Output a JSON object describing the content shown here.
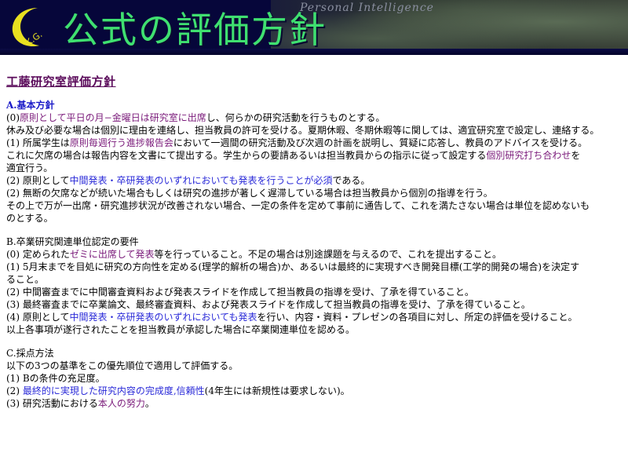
{
  "header": {
    "title": "公式の評価方針",
    "logo_text": "K.G.",
    "motto": "Personal  Intelligence",
    "colors": {
      "title": "#3fe070",
      "logo": "#e8e020",
      "background": "#06063a"
    }
  },
  "doc": {
    "title": "工藤研究室評価方針",
    "sectionA": {
      "heading": "A.基本方針",
      "p0": [
        "(0)",
        "原則として平日の月−金曜日は研究室に出席",
        "し、何らかの研究活動を行うものとする。"
      ],
      "p0b": "休み及び必要な場合は個別に理由を連絡し、担当教員の許可を受ける。夏期休暇、冬期休暇等に関しては、適宜研究室で設定し、連絡する。",
      "p1": [
        "(1) 所属学生は",
        "原則毎週行う進捗報告会",
        "において一週間の研究活動及び次週の計画を説明し、質疑に応答し、教員のアドバイスを受ける。"
      ],
      "p1b": [
        "これに欠席の場合は報告内容を文書にて提出する。学生からの要請あるいは担当教員からの指示に従って設定する",
        "個別研究打ち合わせ",
        "を"
      ],
      "p1c": "適宜行う。",
      "p2": [
        "(2) 原則として",
        "中間発表・卒研発表のいずれにおいても発表を行うことが必須",
        "である。"
      ],
      "p3": "(2) 無断の欠席などが続いた場合もしくは研究の進捗が著しく遅滞している場合は担当教員から個別の指導を行う。",
      "p4": "その上で万が一出席・研究進捗状況が改善されない場合、一定の条件を定めて事前に通告して、これを満たさない場合は単位を認めないも",
      "p4b": "のとする。"
    },
    "sectionB": {
      "heading": "B.卒業研究関連単位認定の要件",
      "p0": [
        "(0) 定められた",
        "ゼミに出席して発表",
        "等を行っていること。不足の場合は別途課題を与えるので、これを提出すること。"
      ],
      "p1": "(1) 5月末までを目処に研究の方向性を定める(理学的解析の場合)か、あるいは最終的に実現すべき開発目標(工学的開発の場合)を決定す",
      "p1b": "ること。",
      "p2": "(2) 中間審査までに中間審査資料および発表スライドを作成して担当教員の指導を受け、了承を得ていること。",
      "p3": "(3) 最終審査までに卒業論文、最終審査資料、および発表スライドを作成して担当教員の指導を受け、了承を得ていること。",
      "p4": [
        "(4) 原則として",
        "中間発表・卒研発表のいずれにおいても発表",
        "を行い、内容・資料・プレゼンの各項目に対し、所定の評価を受けること。"
      ],
      "p5": "以上各事項が遂行されたことを担当教員が承認した場合に卒業関連単位を認める。"
    },
    "sectionC": {
      "heading": "C.採点方法",
      "p0": "以下の3つの基準をこの優先順位で適用して評価する。",
      "p1": "(1) Bの条件の充足度。",
      "p2": [
        "(2) ",
        "最終的に実現した研究内容の完成度,信頼性",
        "(4年生には新規性は要求しない)。"
      ],
      "p3": [
        "(3) 研究活動における",
        "本人の努力",
        "。"
      ]
    }
  }
}
